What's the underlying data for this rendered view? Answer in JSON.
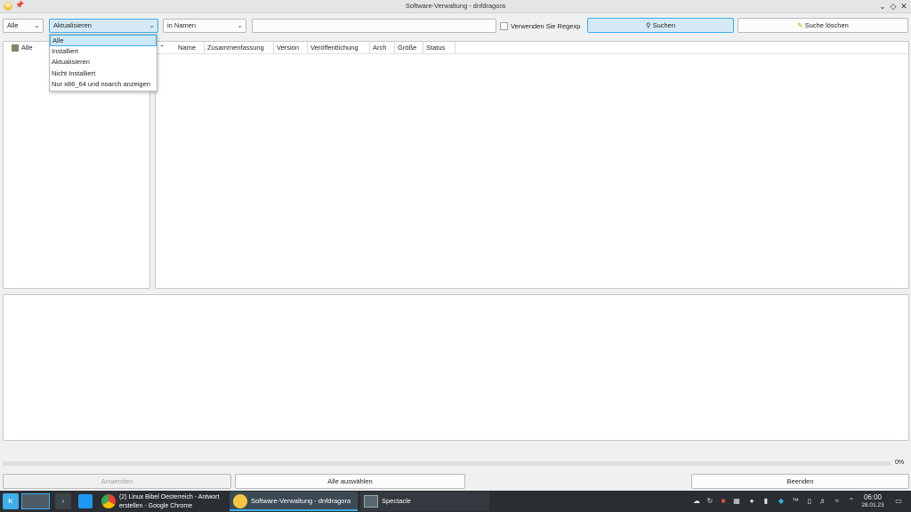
{
  "window": {
    "title": "Software-Verwaltung - dnfdragora"
  },
  "toolbar": {
    "filter_combo": "Alle",
    "status_combo": "Aktualisieren",
    "search_field_combo": "in Namen",
    "search_input": {
      "value": "",
      "placeholder": ""
    },
    "regexp_label": "Verwenden Sie Regexp",
    "search_button": "Suchen",
    "clear_button": "Suche löschen"
  },
  "dropdown": {
    "options": [
      "Alle",
      "Installiert",
      "Aktualisieren",
      "Nicht Installiert",
      "Nur x86_64 und noarch anzeigen"
    ],
    "selected_index": 0
  },
  "tree": {
    "items": [
      "Alle"
    ]
  },
  "table": {
    "columns": [
      "Name",
      "Zusammenfassung",
      "Version",
      "Veröffentlichung",
      "Arch",
      "Größe",
      "Status"
    ]
  },
  "progress": {
    "label": "0%",
    "value": 0
  },
  "bottom_buttons": {
    "apply": "Anwenden",
    "select_all": "Alle auswählen",
    "quit": "Beenden"
  },
  "taskbar": {
    "tasks": [
      {
        "label": "(2) Linux Bibel Oesterreich - Antwort erstellen - Google Chrome"
      },
      {
        "label": "Software-Verwaltung - dnfdragora"
      },
      {
        "label": "Spectacle"
      }
    ],
    "clock_time": "06:00",
    "clock_date": "28.01.23"
  },
  "colors": {
    "accent": "#3daee9",
    "taskbar_bg": "#2a2e32",
    "selected_bg": "#cde8f7"
  }
}
